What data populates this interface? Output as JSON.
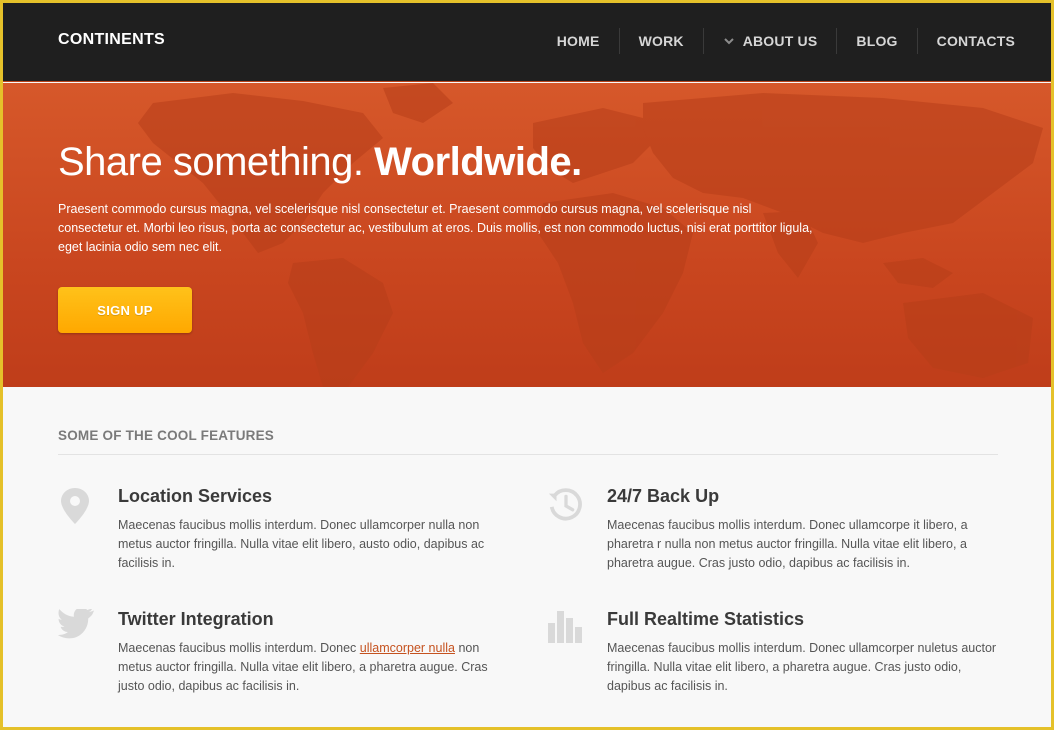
{
  "nav": {
    "brand": "CONTINENTS",
    "items": [
      {
        "label": "HOME"
      },
      {
        "label": "WORK"
      },
      {
        "label": "ABOUT US",
        "icon": "chevron-down-icon"
      },
      {
        "label": "BLOG"
      },
      {
        "label": "CONTACTS"
      }
    ]
  },
  "hero": {
    "title_regular": "Share something.",
    "title_bold": "Worldwide.",
    "text": "Praesent commodo cursus magna, vel scelerisque nisl consectetur et. Praesent commodo cursus magna, vel scelerisque nisl consectetur et. Morbi leo risus, porta ac consectetur ac, vestibulum at eros. Duis mollis, est non commodo luctus, nisi erat porttitor ligula, eget lacinia odio sem nec elit.",
    "signup_label": "SIGN UP"
  },
  "features": {
    "heading": "SOME OF THE COOL FEATURES",
    "items": [
      {
        "title": "Location Services",
        "icon": "map-pin-icon",
        "text": "Maecenas faucibus mollis interdum. Donec ullamcorper nulla non metus auctor fringilla. Nulla vitae elit libero, austo odio, dapibus ac facilisis in."
      },
      {
        "title": "24/7 Back Up",
        "icon": "history-clock-icon",
        "text": "Maecenas faucibus mollis interdum. Donec ullamcorpe it libero, a pharetra r nulla non metus auctor fringilla. Nulla vitae elit libero, a pharetra augue. Cras justo odio, dapibus ac facilisis in."
      },
      {
        "title": "Twitter Integration",
        "icon": "twitter-bird-icon",
        "text_before": "Maecenas faucibus mollis interdum. Donec ",
        "link": "ullamcorper nulla",
        "text_after": " non metus auctor fringilla. Nulla vitae elit libero, a pharetra augue. Cras justo odio, dapibus ac facilisis in."
      },
      {
        "title": "Full Realtime Statistics",
        "icon": "bar-chart-icon",
        "text": "Maecenas faucibus mollis interdum. Donec ullamcorper nuletus auctor fringilla. Nulla vitae elit libero, a pharetra augue. Cras justo odio, dapibus ac facilisis in."
      }
    ]
  },
  "colors": {
    "nav_bg": "#1f1f1f",
    "hero_orange": "#d6582a",
    "button_orange": "#ffa800",
    "link": "#c5521f",
    "frame": "#e5c12a"
  }
}
